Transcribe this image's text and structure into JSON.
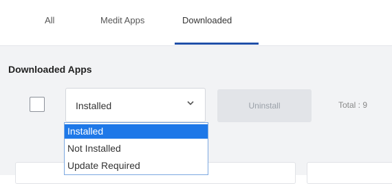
{
  "tabs": [
    {
      "label": "All"
    },
    {
      "label": "Medit Apps"
    },
    {
      "label": "Downloaded"
    }
  ],
  "section": {
    "title": "Downloaded Apps"
  },
  "filter": {
    "selected": "Installed",
    "options": [
      "Installed",
      "Not Installed",
      "Update Required"
    ]
  },
  "actions": {
    "uninstall_label": "Uninstall"
  },
  "summary": {
    "total": "Total : 9"
  },
  "colors": {
    "accent": "#1f4fa8",
    "selected_option": "#1e78e8"
  }
}
